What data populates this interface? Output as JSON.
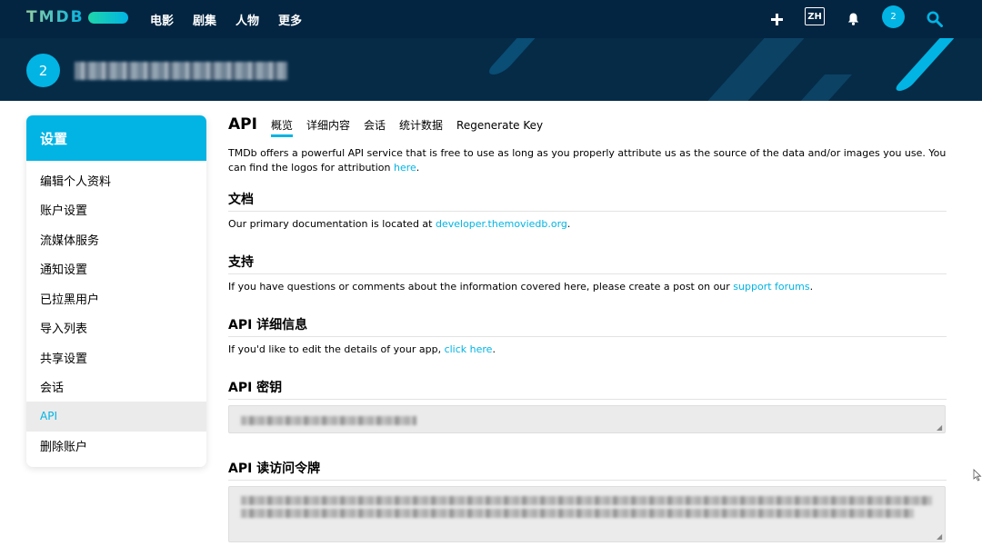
{
  "nav": {
    "logo_text": "TMDB",
    "links": [
      "电影",
      "剧集",
      "人物",
      "更多"
    ],
    "lang": "ZH",
    "avatar_letter": "2"
  },
  "banner": {
    "avatar_letter": "2"
  },
  "sidebar": {
    "title": "设置",
    "items": [
      "编辑个人资料",
      "账户设置",
      "流媒体服务",
      "通知设置",
      "已拉黑用户",
      "导入列表",
      "共享设置",
      "会话",
      "API",
      "删除账户"
    ],
    "active_index": 8
  },
  "main": {
    "title": "API",
    "tabs": [
      "概览",
      "详细内容",
      "会话",
      "统计数据",
      "Regenerate Key"
    ],
    "intro_text": "TMDb offers a powerful API service that is free to use as long as you properly attribute us as the source of the data and/or images you use. You can find the logos for attribution ",
    "intro_link": "here",
    "sections": {
      "docs": {
        "heading": "文档",
        "text": "Our primary documentation is located at ",
        "link": "developer.themoviedb.org"
      },
      "support": {
        "heading": "支持",
        "text": "If you have questions or comments about the information covered here, please create a post on our ",
        "link": "support forums"
      },
      "details": {
        "heading": "API 详细信息",
        "text": "If you'd like to edit the details of your app, ",
        "link": "click here"
      },
      "key": {
        "heading": "API 密钥"
      },
      "token": {
        "heading": "API 读访问令牌"
      }
    }
  },
  "colors": {
    "nav_bg": "#032541",
    "accent": "#01b4e4",
    "link": "#01b4e4"
  }
}
